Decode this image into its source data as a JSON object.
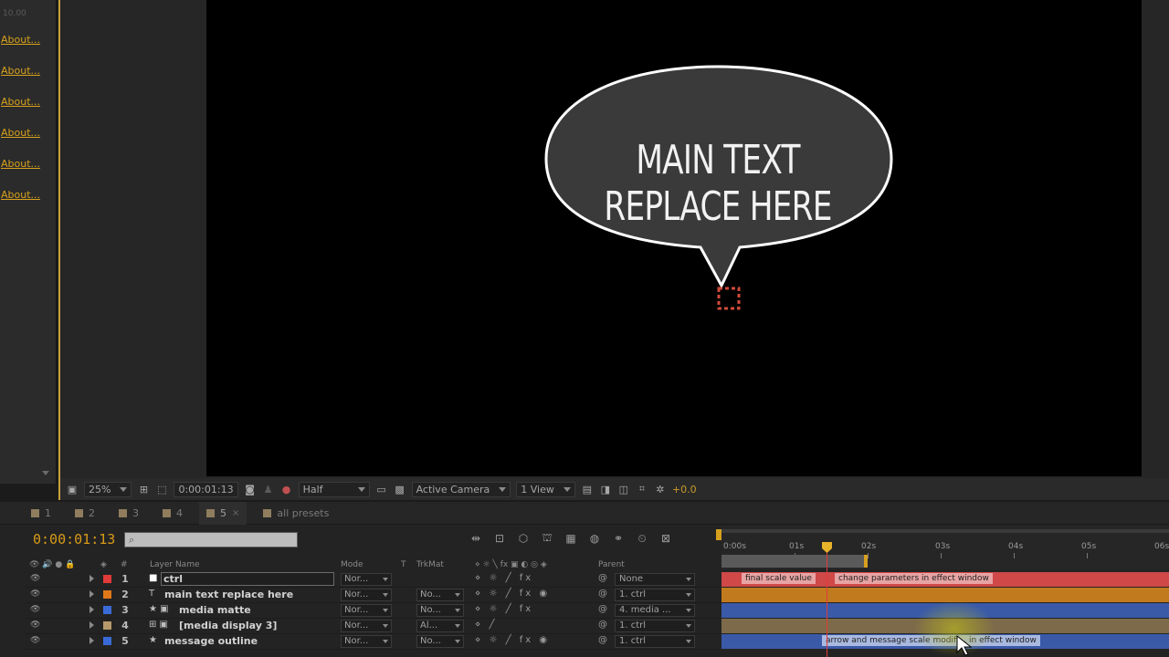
{
  "left_panel": {
    "top_number": "10.00",
    "about_links": [
      "About...",
      "About...",
      "About...",
      "About...",
      "About...",
      "About..."
    ]
  },
  "comp": {
    "bubble_text": "MAIN TEXT REPLACE HERE",
    "bubble_fill": "#3a3a3a",
    "bubble_stroke": "#ffffff",
    "null_box_color": "#d04a3a"
  },
  "viewer_toolbar": {
    "zoom": "25%",
    "timecode": "0:00:01:13",
    "resolution": "Half",
    "camera": "Active Camera",
    "views": "1 View",
    "exposure": "+0.0"
  },
  "tabs": [
    {
      "label": "1",
      "active": false,
      "color": "#8f7d5d"
    },
    {
      "label": "2",
      "active": false,
      "color": "#8f7d5d"
    },
    {
      "label": "3",
      "active": false,
      "color": "#8f7d5d"
    },
    {
      "label": "4",
      "active": false,
      "color": "#8f7d5d"
    },
    {
      "label": "5",
      "active": true,
      "color": "#8f7d5d"
    },
    {
      "label": "all presets",
      "active": false,
      "color": "#8f7d5d"
    }
  ],
  "timeline": {
    "current_time": "0:00:01:13",
    "columns": {
      "hash": "#",
      "layer_name": "Layer Name",
      "mode": "Mode",
      "t": "T",
      "trkmat": "TrkMat",
      "parent": "Parent"
    },
    "ruler_ticks": [
      "0:00s",
      "01s",
      "02s",
      "03s",
      "04s",
      "05s",
      "06s"
    ],
    "layers": [
      {
        "num": "1",
        "name": "ctrl",
        "label_color": "#e03a3a",
        "icon": "solid",
        "mode": "Nor...",
        "trkmat": "",
        "parent": "None",
        "editing": true
      },
      {
        "num": "2",
        "name": "main text replace here",
        "label_color": "#e0781a",
        "icon": "text",
        "mode": "Nor...",
        "trkmat": "No...",
        "parent": "1. ctrl",
        "editing": false
      },
      {
        "num": "3",
        "name": "media matte",
        "label_color": "#3a6ad8",
        "icon": "shape",
        "mode": "Nor...",
        "trkmat": "No...",
        "parent": "4. media ...",
        "editing": false
      },
      {
        "num": "4",
        "name": "[media display 3]",
        "label_color": "#b89a6a",
        "icon": "precomp",
        "mode": "Nor...",
        "trkmat": "Al...",
        "parent": "1. ctrl",
        "editing": false
      },
      {
        "num": "5",
        "name": "message outline",
        "label_color": "#3a6ad8",
        "icon": "shape",
        "mode": "Nor...",
        "trkmat": "No...",
        "parent": "1. ctrl",
        "editing": false
      }
    ],
    "track_labels": {
      "final_scale": "final scale value",
      "change_params": "change parameters in effect window",
      "arrow_message": "arrow and message scale modifi... in effect window"
    }
  }
}
